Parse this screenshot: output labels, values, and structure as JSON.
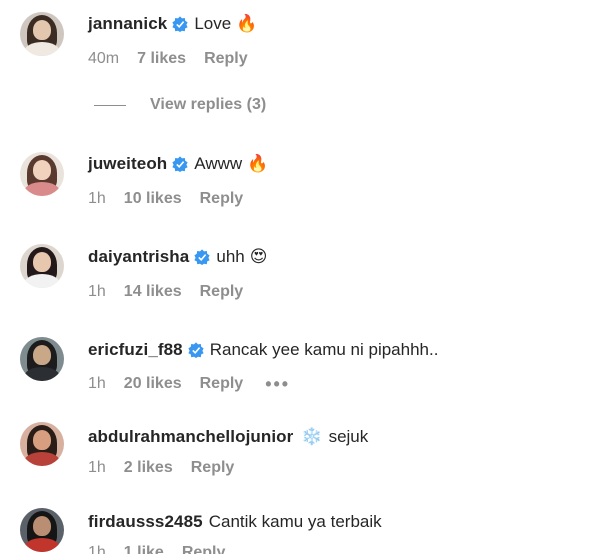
{
  "comments": [
    {
      "username": "jannanick",
      "verified": true,
      "text": "Love",
      "emoji": "🔥",
      "time": "40m",
      "likes": "7 likes",
      "reply": "Reply",
      "avatar_colors": {
        "bg": "#cfc7bf",
        "hair": "#3a2c22",
        "face": "#e2c6ad",
        "body": "#efe9e2"
      }
    },
    {
      "username": "juweiteoh",
      "verified": true,
      "text": "Awww",
      "emoji": "🔥",
      "time": "1h",
      "likes": "10 likes",
      "reply": "Reply",
      "avatar_colors": {
        "bg": "#e9e3dc",
        "hair": "#5a3a2e",
        "face": "#f0d2bd",
        "body": "#d98a8a"
      }
    },
    {
      "username": "daiyantrisha",
      "verified": true,
      "text": "uhh",
      "emoji": "😍",
      "time": "1h",
      "likes": "14 likes",
      "reply": "Reply",
      "avatar_colors": {
        "bg": "#ddd6cf",
        "hair": "#24191a",
        "face": "#e7c7ae",
        "body": "#f2f2f2"
      }
    },
    {
      "username": "ericfuzi_f88",
      "verified": true,
      "text": "Rancak yee kamu ni pipahhh..",
      "emoji": "",
      "time": "1h",
      "likes": "20 likes",
      "reply": "Reply",
      "more": "•••",
      "avatar_colors": {
        "bg": "#7e8b8f",
        "hair": "#1c1c1c",
        "face": "#c9a888",
        "body": "#2b2f33"
      }
    },
    {
      "username": "abdulrahmanchellojunior",
      "verified": false,
      "text": "sejuk",
      "emoji": "❄️",
      "time": "1h",
      "likes": "2 likes",
      "reply": "Reply",
      "avatar_colors": {
        "bg": "#d7b0a0",
        "hair": "#2a1d17",
        "face": "#d79e80",
        "body": "#b8413a"
      }
    },
    {
      "username": "firdausss2485",
      "verified": false,
      "text": "Cantik kamu ya terbaik",
      "emoji": "",
      "time": "1h",
      "likes": "1 like",
      "reply": "Reply",
      "avatar_colors": {
        "bg": "#5b6168",
        "hair": "#151515",
        "face": "#b98e72",
        "body": "#c1352d"
      }
    }
  ],
  "view_replies": {
    "label": "View replies (3)"
  },
  "colors": {
    "verified": "#3897f0",
    "text": "#262626",
    "meta": "#8e8e8e"
  }
}
